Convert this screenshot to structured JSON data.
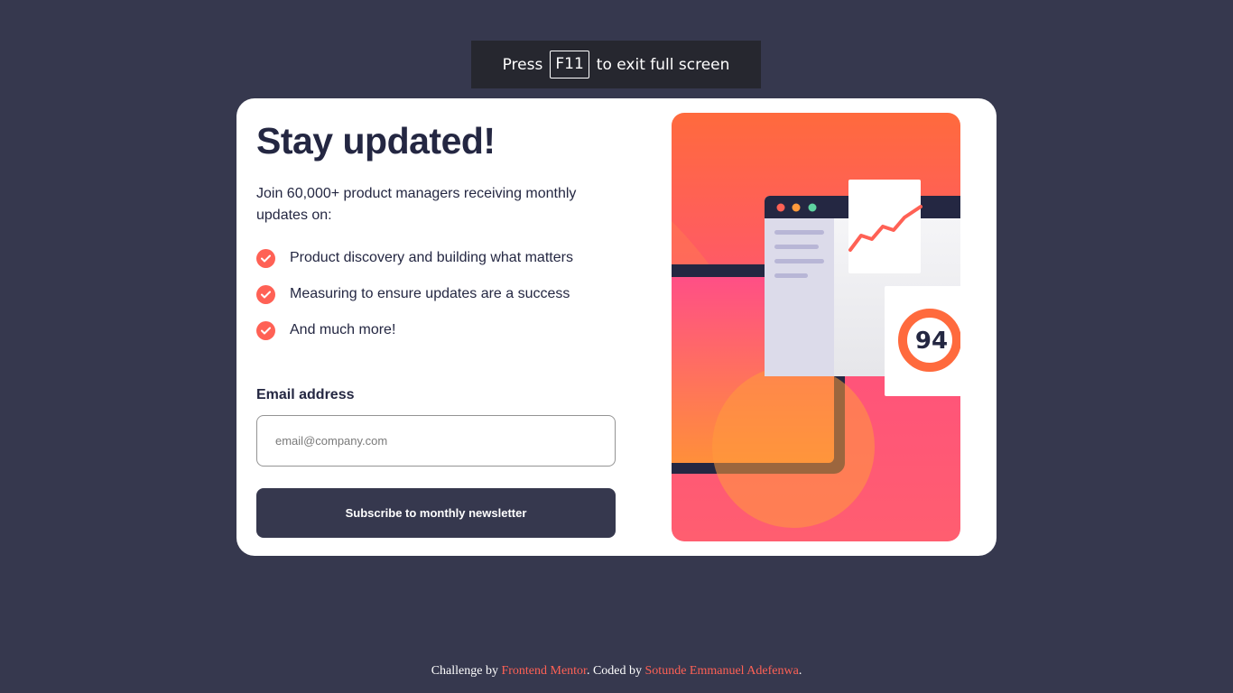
{
  "fullscreen_notice": {
    "prefix": "Press",
    "key": "F11",
    "suffix": "to exit full screen"
  },
  "card": {
    "title": "Stay updated!",
    "intro": "Join 60,000+ product managers receiving monthly updates on:",
    "features": [
      "Product discovery and building what matters",
      "Measuring to ensure updates are a success",
      "And much more!"
    ],
    "email_label": "Email address",
    "email_placeholder": "email@company.com",
    "email_value": "",
    "button_label": "Subscribe to monthly newsletter"
  },
  "illustration": {
    "score": "94"
  },
  "footer": {
    "prefix": "Challenge by",
    "link1": "Frontend Mentor",
    "middle": ". Coded by",
    "link2": "Sotunde Emmanuel Adefenwa",
    "suffix": "."
  },
  "colors": {
    "background": "#36384e",
    "card": "#ffffff",
    "accent": "#ff6155",
    "text_dark": "#242742",
    "button": "#36384e"
  },
  "icons": [
    "check-icon"
  ]
}
